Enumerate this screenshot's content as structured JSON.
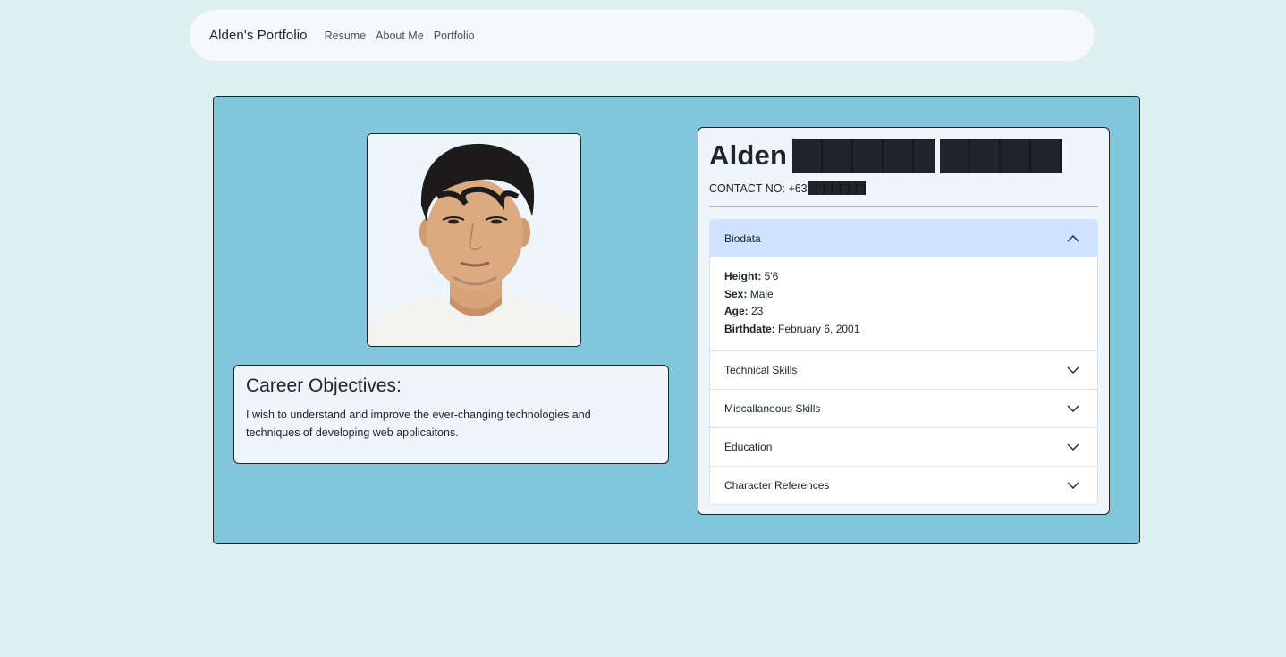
{
  "navbar": {
    "brand": "Alden's Portfolio",
    "links": [
      "Resume",
      "About Me",
      "Portfolio"
    ]
  },
  "profile": {
    "first_name": "Alden",
    "contact_label": "CONTACT NO: +63",
    "photo_alt": "profile photo"
  },
  "objectives": {
    "heading": "Career Objectives:",
    "text": "I wish to understand and improve the ever-changing technologies and techniques of developing web applicaitons."
  },
  "accordion": {
    "items": [
      {
        "label": "Biodata",
        "open": true
      },
      {
        "label": "Technical Skills",
        "open": false
      },
      {
        "label": "Miscallaneous Skills",
        "open": false
      },
      {
        "label": "Education",
        "open": false
      },
      {
        "label": "Character References",
        "open": false
      }
    ],
    "biodata": [
      {
        "key": "Height:",
        "value": " 5'6"
      },
      {
        "key": "Sex:",
        "value": " Male"
      },
      {
        "key": "Age:",
        "value": " 23"
      },
      {
        "key": "Birthdate:",
        "value": " February 6, 2001"
      }
    ]
  },
  "colors": {
    "page_bg": "#dcf1ef",
    "card_bg": "#81c6db",
    "panel_bg": "#eef6fc",
    "accordion_active": "#cfe2ff"
  },
  "icons": {
    "open_chevron": "chevron-up-icon",
    "closed_chevron": "chevron-down-icon"
  }
}
